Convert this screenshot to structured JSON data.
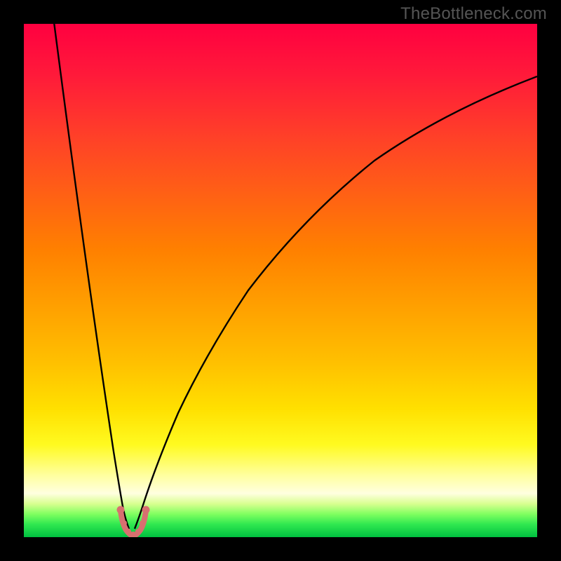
{
  "watermark": "TheBottleneck.com",
  "chart_data": {
    "type": "line",
    "title": "",
    "xlabel": "",
    "ylabel": "",
    "xlim": [
      0,
      100
    ],
    "ylim": [
      0,
      100
    ],
    "grid": false,
    "legend": false,
    "series": [
      {
        "name": "bottleneck-curve",
        "x": [
          0,
          2,
          4,
          6,
          8,
          10,
          12,
          14,
          16,
          17,
          18,
          19,
          20,
          21,
          22,
          23,
          24,
          26,
          28,
          30,
          34,
          38,
          42,
          46,
          50,
          55,
          60,
          65,
          70,
          75,
          80,
          85,
          90,
          95,
          100
        ],
        "y": [
          100,
          90,
          80,
          70,
          60,
          50,
          41,
          32,
          20,
          13,
          7,
          3,
          1,
          0.5,
          0.5,
          1,
          3,
          8,
          14,
          20,
          30,
          38,
          45,
          51,
          56,
          62,
          67,
          71,
          75,
          78,
          81,
          84,
          86,
          88,
          90
        ]
      }
    ],
    "optimal_region": {
      "center_x": 20.5,
      "markers_x": [
        18.5,
        19,
        19.5,
        20,
        20.5,
        21,
        21.5,
        22,
        22.5
      ],
      "markers_y": [
        4,
        2,
        1,
        0.7,
        0.5,
        0.7,
        1,
        2,
        4
      ]
    },
    "background_gradient": {
      "top": "#ff0040",
      "mid": "#ffe000",
      "bottom": "#00c040"
    }
  }
}
